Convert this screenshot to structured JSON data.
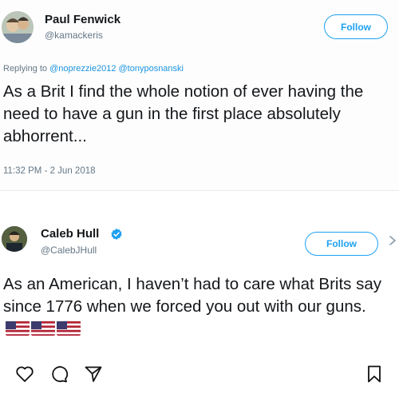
{
  "tweet1": {
    "name": "Paul Fenwick",
    "handle": "@kamackeris",
    "follow_label": "Follow",
    "reply_prefix": "Replying to",
    "reply_mentions": "@noprezzie2012 @tonyposnanski",
    "text": "As a Brit I find the whole notion of ever having the need to have a gun in the first place absolutely abhorrent...",
    "timestamp": "11:32 PM - 2 Jun 2018"
  },
  "tweet2": {
    "name": "Caleb Hull",
    "handle": "@CalebJHull",
    "follow_label": "Follow",
    "verified": true,
    "text": "As an American, I haven’t had to care what Brits say since 1776 when we forced you out with our guns.",
    "flag_count": 3
  },
  "icons": {
    "verified": "verified-badge-icon",
    "more": "chevron-down-icon",
    "like": "heart-icon",
    "comment": "comment-icon",
    "share": "send-icon",
    "save": "bookmark-icon",
    "flag": "us-flag-icon"
  },
  "colors": {
    "accent": "#1da1f2",
    "text": "#14171a",
    "muted": "#657786",
    "mention": "#1b95e0"
  }
}
